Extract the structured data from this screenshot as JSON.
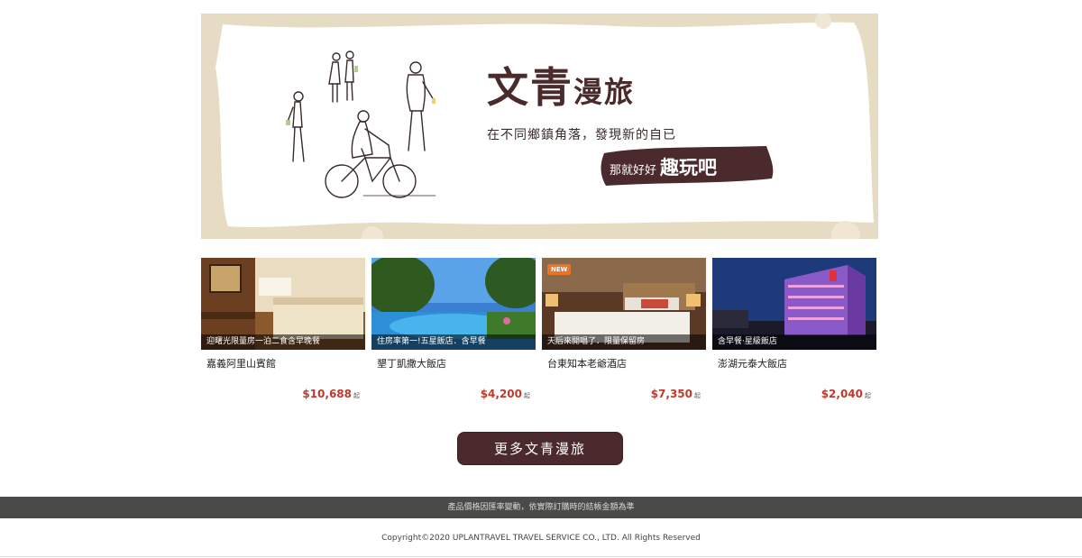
{
  "banner": {
    "title_big": "文青",
    "title_small": "漫旅",
    "subtitle": "在不同鄉鎮角落，發現新的自已",
    "slogan_a": "那就好好",
    "slogan_b": "趣玩吧",
    "colors": {
      "frame": "#e6dcc4",
      "paper": "#ffffff",
      "ink": "#4a2a2a"
    }
  },
  "hotels": [
    {
      "caption": "迎曙光限量房一泊二食含早晚餐",
      "name": "嘉義阿里山賓館",
      "price": "$10,688",
      "unit": "起",
      "new": false
    },
    {
      "caption": "住房率第一!五星飯店．含早餐",
      "name": "墾丁凱撒大飯店",
      "price": "$4,200",
      "unit": "起",
      "new": false
    },
    {
      "caption": "天后來開唱了．限量保留房",
      "name": "台東知本老爺酒店",
      "price": "$7,350",
      "unit": "起",
      "new": true,
      "badge": "NEW"
    },
    {
      "caption": "含早餐‧星級飯店",
      "name": "澎湖元泰大飯店",
      "price": "$2,040",
      "unit": "起",
      "new": false
    }
  ],
  "more_button": "更多文青漫旅",
  "footer": {
    "note": "產品價格因匯率變動，依實際訂購時的結帳金額為準",
    "copyright": "Copyright©2020 UPLANTRAVEL TRAVEL SERVICE CO., LTD. All Rights Reserved"
  },
  "colors": {
    "price": "#c0392b",
    "button": "#4b2a2e",
    "footer_bar": "#4a4a48"
  }
}
